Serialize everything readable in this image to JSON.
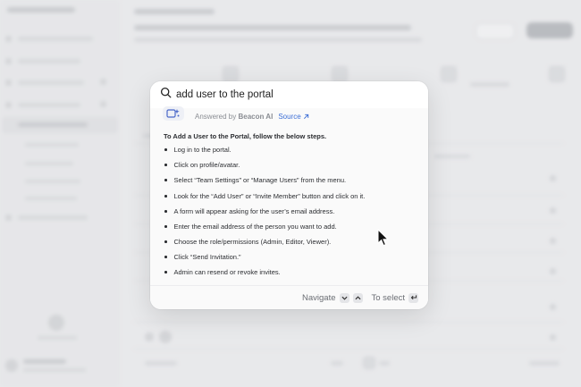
{
  "search": {
    "query": "add user to the portal",
    "placeholder": ""
  },
  "answer": {
    "answered_prefix": "Answered by",
    "provider": "Beacon AI",
    "source_label": "Source",
    "intro": "To Add a User to the Portal, follow the below steps.",
    "steps": [
      "Log in to the portal.",
      "Click on profile/avatar.",
      "Select “Team Settings” or “Manage Users” from the menu.",
      "Look for the “Add User” or “Invite Member” button and click  on it.",
      "A form will appear asking for the user’s email address.",
      "Enter the email address of the person you want to add.",
      "Choose the role/permissions (Admin, Editor, Viewer).",
      "Click “Send Invitation.”",
      "Admin can resend or revoke invites."
    ]
  },
  "footer": {
    "navigate_label": "Navigate",
    "select_label": "To select"
  },
  "icons": {
    "search": "search-icon",
    "ai_badge": "ai-sparkle-icon",
    "source": "external-link-icon",
    "down": "chevron-down-icon",
    "up": "chevron-up-icon",
    "enter": "enter-key-icon",
    "cursor": "mouse-pointer-icon"
  },
  "colors": {
    "accent": "#3d6fd6",
    "text": "#2b2d31",
    "muted": "#8a8d93"
  }
}
